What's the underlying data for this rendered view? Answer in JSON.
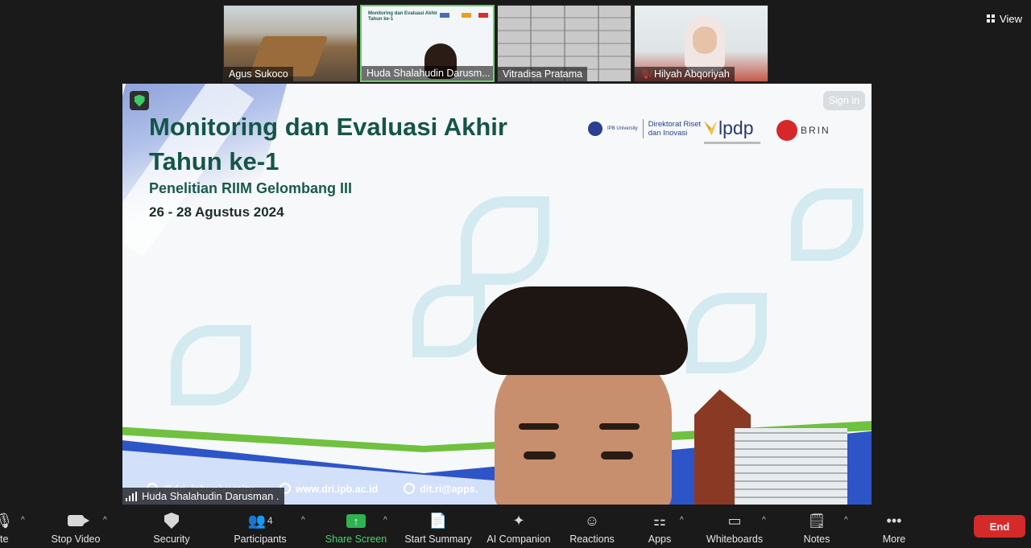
{
  "thumbnails": [
    {
      "name": "Agus Sukoco",
      "muted": false,
      "active": false
    },
    {
      "name": "Huda Shalahudin Darusm...",
      "muted": false,
      "active": true
    },
    {
      "name": "Vitradisa Pratama",
      "muted": false,
      "active": false
    },
    {
      "name": "Hilyah Abqoriyah",
      "muted": true,
      "active": false
    }
  ],
  "view_label": "View",
  "slide": {
    "title": "Monitoring dan Evaluasi Akhir Tahun ke-1",
    "subtitle": "Penelitian RIIM Gelombang III",
    "dates": "26 - 28 Agustus 2024",
    "ipb_text": "IPB University",
    "directorate": "Direktorat Riset dan Inovasi",
    "lpdp": "lpdp",
    "brin": "BRIN",
    "contacts": [
      "@dri_ipbuniversity",
      "www.dri.ipb.ac.id",
      "dit.ri@apps."
    ]
  },
  "signin_label": "Sign in",
  "speaker_name": "Huda Shalahudin Darusman .",
  "toolbar": {
    "mute_partial": "te",
    "stop_video": "Stop Video",
    "security": "Security",
    "participants": "Participants",
    "participants_count": "4",
    "share_screen": "Share Screen",
    "start_summary": "Start Summary",
    "ai_companion": "AI Companion",
    "reactions": "Reactions",
    "apps": "Apps",
    "whiteboards": "Whiteboards",
    "notes": "Notes",
    "more": "More",
    "end": "End"
  },
  "colors": {
    "accent_green": "#4fd16e",
    "end_red": "#d62a2a",
    "slide_title": "#155548"
  }
}
